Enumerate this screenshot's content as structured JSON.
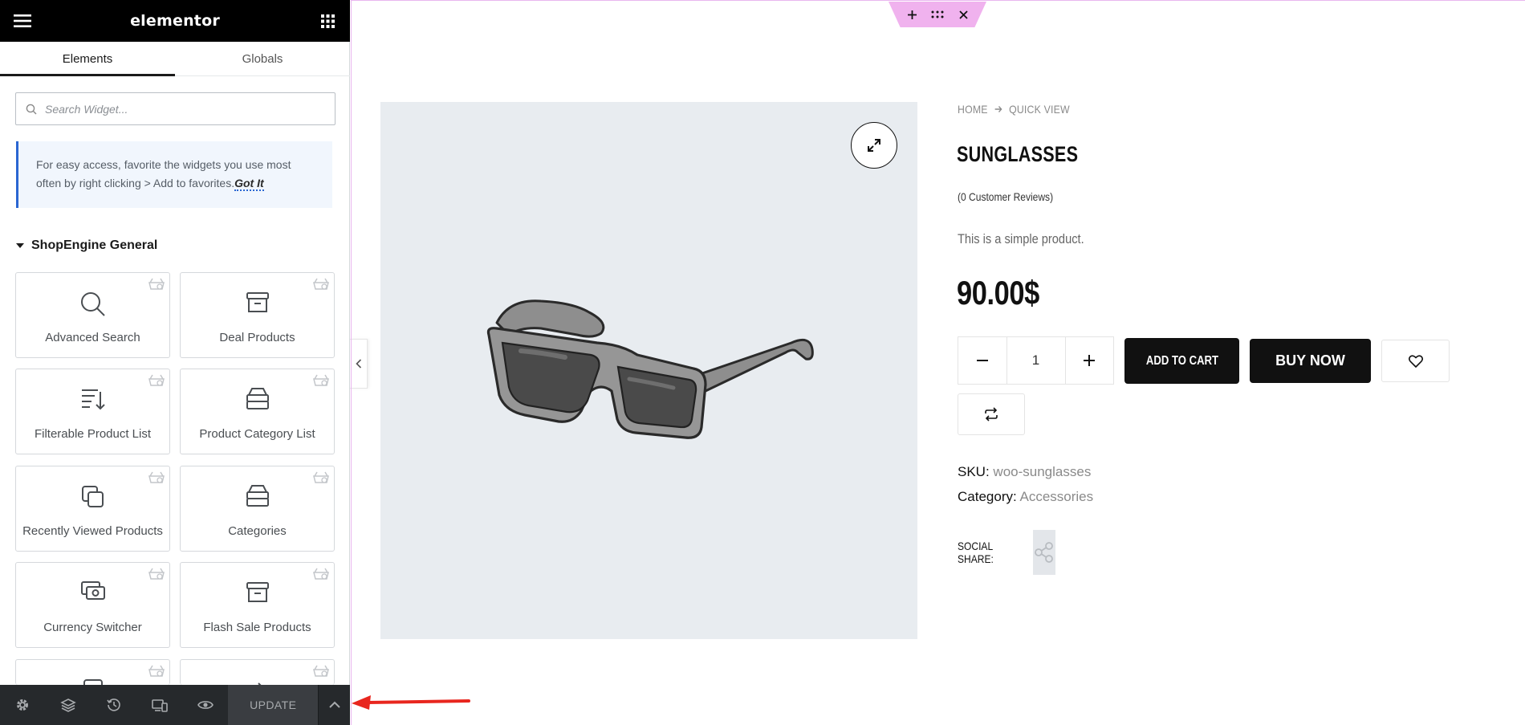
{
  "panel": {
    "logo": "elementor",
    "tabs": [
      {
        "label": "Elements"
      },
      {
        "label": "Globals"
      }
    ],
    "search": {
      "placeholder": "Search Widget..."
    },
    "notice": {
      "text": "For easy access, favorite the widgets you use most often by right clicking > Add to favorites.",
      "link": "Got It"
    },
    "category": "ShopEngine General",
    "widgets": [
      {
        "label": "Advanced Search",
        "icon": "search-icon"
      },
      {
        "label": "Deal Products",
        "icon": "archive-box-icon"
      },
      {
        "label": "Filterable Product List",
        "icon": "sort-list-icon"
      },
      {
        "label": "Product Category List",
        "icon": "stack-icon"
      },
      {
        "label": "Recently Viewed Products",
        "icon": "copy-icon"
      },
      {
        "label": "Categories",
        "icon": "stack-icon"
      },
      {
        "label": "Currency Switcher",
        "icon": "money-icon"
      },
      {
        "label": "Flash Sale Products",
        "icon": "archive-box-icon"
      }
    ],
    "footer": {
      "update_label": "UPDATE"
    }
  },
  "product": {
    "breadcrumb": [
      "HOME",
      "QUICK VIEW"
    ],
    "title": "SUNGLASSES",
    "reviews": "(0 Customer Reviews)",
    "description": "This is a simple product.",
    "price": "90.00$",
    "quantity": "1",
    "add_to_cart_label": "ADD TO CART",
    "buy_now_label": "BUY NOW",
    "sku_label": "SKU:",
    "sku_value": "woo-sunglasses",
    "category_label": "Category:",
    "category_value": "Accessories",
    "social_label": "SOCIAL SHARE:"
  },
  "colors": {
    "accent_pink": "#f0b2ee",
    "notice_blue": "#2a66d2",
    "annotation_red": "#e8261e"
  }
}
